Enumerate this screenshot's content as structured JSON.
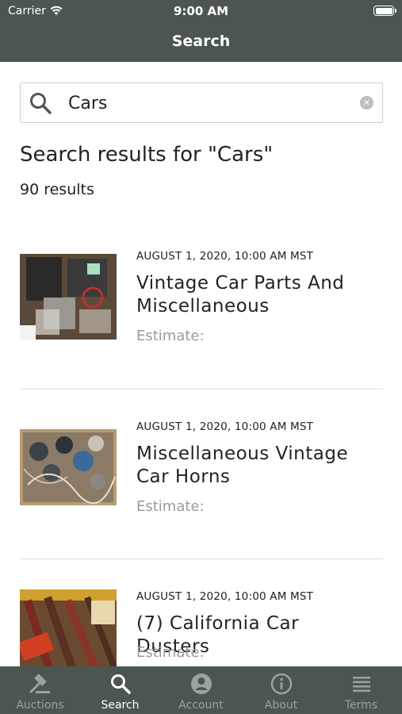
{
  "status_bar": {
    "carrier": "Carrier",
    "time": "9:00 AM"
  },
  "nav": {
    "title": "Search"
  },
  "search": {
    "value": "Cars",
    "placeholder": ""
  },
  "results": {
    "heading": "Search results for \"Cars\"",
    "count": "90 results",
    "items": [
      {
        "date": "AUGUST 1, 2020, 10:00 AM MST",
        "title": "Vintage Car Parts And Miscellaneous",
        "estimate": "Estimate:"
      },
      {
        "date": "AUGUST 1, 2020, 10:00 AM MST",
        "title": "Miscellaneous Vintage Car Horns",
        "estimate": "Estimate:"
      },
      {
        "date": "AUGUST 1, 2020, 10:00 AM MST",
        "title": "(7) California Car Dusters",
        "estimate": "Estimate:"
      }
    ]
  },
  "tabs": [
    {
      "label": "Auctions",
      "icon": "gavel-icon",
      "active": false
    },
    {
      "label": "Search",
      "icon": "search-icon",
      "active": true
    },
    {
      "label": "Account",
      "icon": "account-icon",
      "active": false
    },
    {
      "label": "About",
      "icon": "info-icon",
      "active": false
    },
    {
      "label": "Terms",
      "icon": "terms-icon",
      "active": false
    }
  ],
  "colors": {
    "bar": "#4b5651",
    "tab_inactive": "#9aa39e",
    "tab_active": "#ffffff",
    "estimate": "#9a9a9a"
  }
}
